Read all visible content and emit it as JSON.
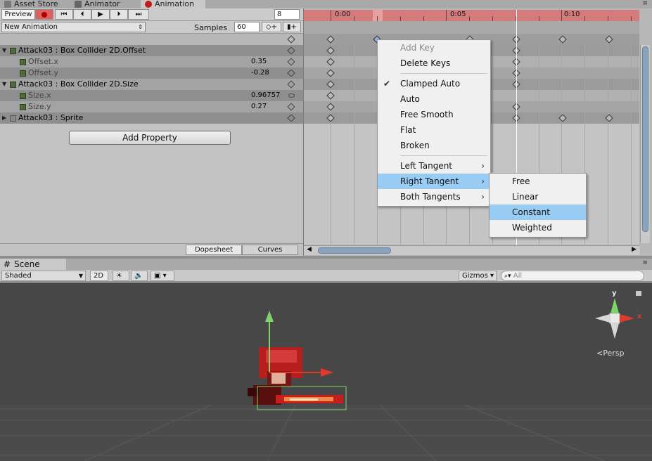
{
  "tabs": [
    {
      "label": "Asset Store",
      "icon": "bag-icon"
    },
    {
      "label": "Animator",
      "icon": "animator-icon"
    },
    {
      "label": "Animation",
      "icon": "record-dot-icon"
    }
  ],
  "toolbar": {
    "preview_label": "Preview",
    "frame_value": "8",
    "clip_name": "New Animation",
    "samples_label": "Samples",
    "samples_value": "60"
  },
  "properties": [
    {
      "name": "Attack03 : Box Collider 2D.Offset",
      "value": "",
      "level": 0
    },
    {
      "name": "Offset.x",
      "value": "0.35",
      "level": 1
    },
    {
      "name": "Offset.y",
      "value": "-0.28",
      "level": 1
    },
    {
      "name": "Attack03 : Box Collider 2D.Size",
      "value": "",
      "level": 0
    },
    {
      "name": "Size.x",
      "value": "0.96757",
      "level": 1
    },
    {
      "name": "Size.y",
      "value": "0.27",
      "level": 1
    },
    {
      "name": "Attack03 : Sprite",
      "value": "",
      "level": 0
    }
  ],
  "add_property_label": "Add Property",
  "bottom_tabs": {
    "dopesheet": "Dopesheet",
    "curves": "Curves"
  },
  "timeline": {
    "labels": [
      "0:00",
      "0:05",
      "0:10"
    ]
  },
  "context_menu": {
    "items": [
      {
        "label": "Add Key",
        "disabled": true
      },
      {
        "label": "Delete Keys"
      },
      {
        "label": "Clamped Auto",
        "checked": true
      },
      {
        "label": "Auto"
      },
      {
        "label": "Free Smooth"
      },
      {
        "label": "Flat"
      },
      {
        "label": "Broken"
      },
      {
        "label": "Left Tangent",
        "submenu": true
      },
      {
        "label": "Right Tangent",
        "submenu": true,
        "highlighted": true
      },
      {
        "label": "Both Tangents",
        "submenu": true
      }
    ]
  },
  "submenu": {
    "items": [
      {
        "label": "Free"
      },
      {
        "label": "Linear"
      },
      {
        "label": "Constant",
        "highlighted": true
      },
      {
        "label": "Weighted"
      }
    ]
  },
  "scene": {
    "tab_label": "Scene",
    "shading_mode": "Shaded",
    "mode_2d": "2D",
    "gizmos_label": "Gizmos",
    "search_placeholder": "All",
    "persp_label": "Persp",
    "axis_y": "y",
    "axis_x": "x"
  },
  "colors": {
    "highlight": "#99ccf2",
    "timeline": "#d47b7b",
    "record": "#cc2222"
  }
}
